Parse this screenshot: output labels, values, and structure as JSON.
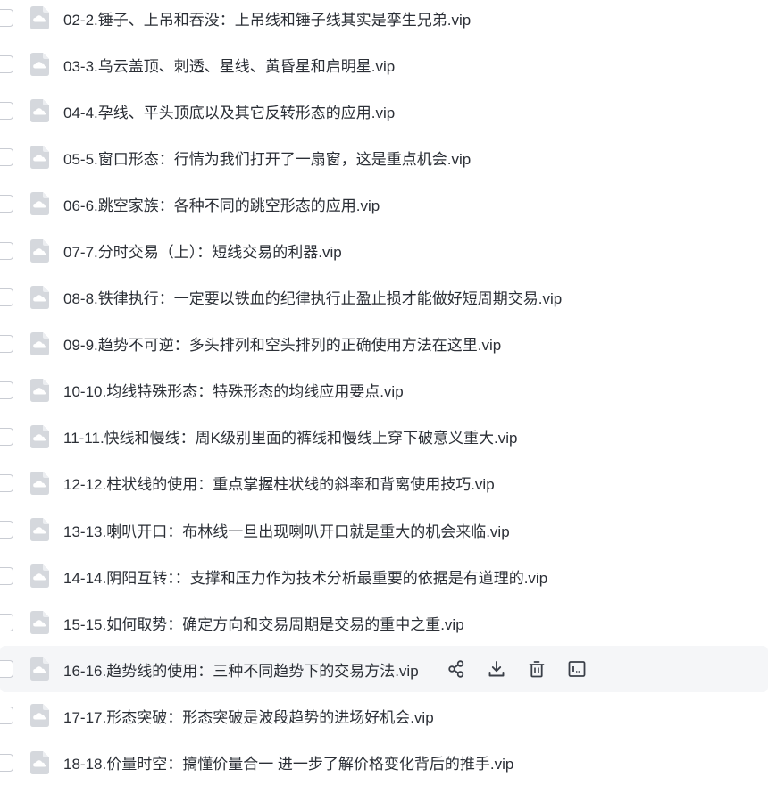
{
  "files": [
    {
      "name": "02-2.锤子、上吊和吞没：上吊线和锤子线其实是孪生兄弟.vip"
    },
    {
      "name": "03-3.乌云盖顶、刺透、星线、黄昏星和启明星.vip"
    },
    {
      "name": "04-4.孕线、平头顶底以及其它反转形态的应用.vip"
    },
    {
      "name": "05-5.窗口形态：行情为我们打开了一扇窗，这是重点机会.vip"
    },
    {
      "name": "06-6.跳空家族：各种不同的跳空形态的应用.vip"
    },
    {
      "name": "07-7.分时交易（上）：短线交易的利器.vip"
    },
    {
      "name": "08-8.铁律执行：一定要以铁血的纪律执行止盈止损才能做好短周期交易.vip"
    },
    {
      "name": "09-9.趋势不可逆：多头排列和空头排列的正确使用方法在这里.vip"
    },
    {
      "name": "10-10.均线特殊形态：特殊形态的均线应用要点.vip"
    },
    {
      "name": "11-11.快线和慢线：周K级别里面的裤线和慢线上穿下破意义重大.vip"
    },
    {
      "name": "12-12.柱状线的使用：重点掌握柱状线的斜率和背离使用技巧.vip"
    },
    {
      "name": "13-13.喇叭开口：布林线一旦出现喇叭开口就是重大的机会来临.vip"
    },
    {
      "name": "14-14.阴阳互转：：支撑和压力作为技术分析最重要的依据是有道理的.vip"
    },
    {
      "name": "15-15.如何取势：确定方向和交易周期是交易的重中之重.vip"
    },
    {
      "name": "16-16.趋势线的使用：三种不同趋势下的交易方法.vip"
    },
    {
      "name": "17-17.形态突破：形态突破是波段趋势的进场好机会.vip"
    },
    {
      "name": "18-18.价量时空：搞懂价量合一 进一步了解价格变化背后的推手.vip"
    }
  ],
  "hover_index": 14,
  "row_actions": [
    "share-icon",
    "download-icon",
    "delete-icon",
    "rename-icon"
  ],
  "colors": {
    "icon": "#d5d8dd",
    "hover_bg": "#f5f6f8",
    "action": "#3a3f48"
  }
}
